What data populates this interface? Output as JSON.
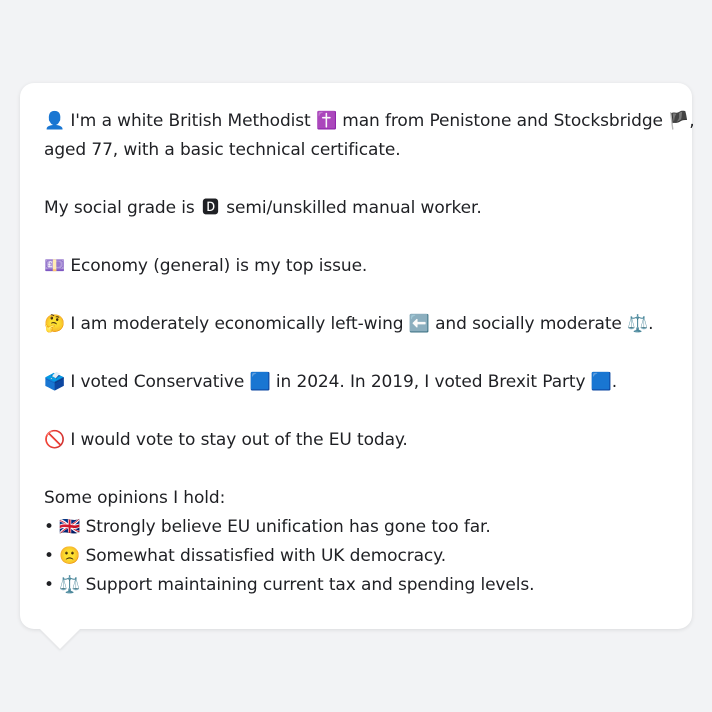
{
  "profile": {
    "identity": {
      "icon": "👤",
      "text_a": "I'm a white British Methodist",
      "icon_b": "✝️",
      "text_b": "man from Penistone and Stocksbridge",
      "icon_c": "🏴",
      "text_c": ",",
      "line2": "aged 77, with a basic technical certificate."
    },
    "social_grade": {
      "text_a": "My social grade is",
      "icon": "🅳",
      "text_b": "semi/unskilled manual worker."
    },
    "top_issue": {
      "icon": "💷",
      "text": "Economy (general) is my top issue."
    },
    "ideology": {
      "icon": "🤔",
      "text_a": "I am moderately economically left-wing",
      "icon_b": "⬅️",
      "text_b": "and socially moderate",
      "icon_c": "⚖️",
      "text_c": "."
    },
    "vote": {
      "icon": "🗳️",
      "text_a": "I voted Conservative",
      "icon_b": "🟦",
      "text_b": "in 2024. In 2019, I voted Brexit Party",
      "icon_c": "🟦",
      "text_c": "."
    },
    "eu": {
      "icon": "🚫",
      "text": "I would vote to stay out of the EU today."
    },
    "opinions": {
      "heading": "Some opinions I hold:",
      "bullet": "•",
      "items": [
        {
          "icon": "🇬🇧",
          "text": "Strongly believe EU unification has gone too far."
        },
        {
          "icon": "🙁",
          "text": "Somewhat dissatisfied with UK democracy."
        },
        {
          "icon": "⚖️",
          "text": "Support maintaining current tax and spending levels."
        }
      ]
    }
  },
  "colors": {
    "background": "#f2f3f5",
    "card": "#ffffff",
    "text": "#1f2024"
  }
}
